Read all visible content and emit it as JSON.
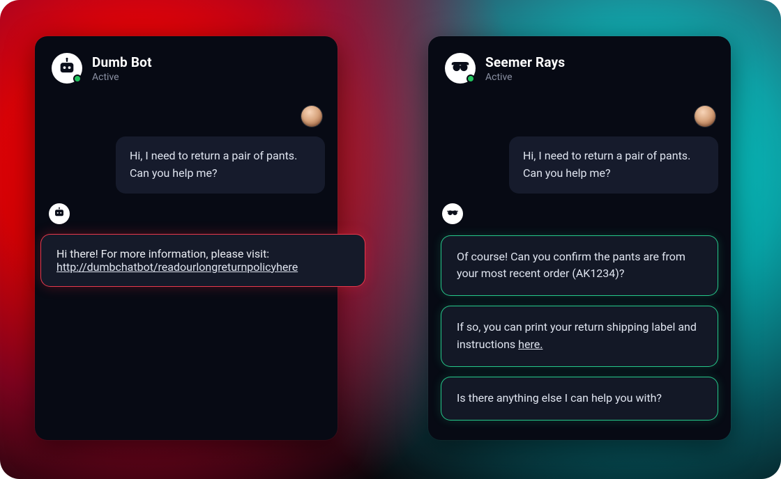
{
  "left": {
    "name": "Dumb Bot",
    "status": "Active",
    "user_msg": "Hi, I need to return a pair of pants. Can you help me?",
    "bot_line_prefix": "Hi there! For more information, please visit:",
    "bot_link": "http://dumbchatbot/readourlongreturnpolicyhere"
  },
  "right": {
    "name": "Seemer Rays",
    "status": "Active",
    "user_msg": "Hi, I need to return a pair of pants. Can you help me?",
    "bot_msg1": "Of course!  Can you confirm the pants are from your most recent order (AK1234)?",
    "bot_msg2_prefix": "If so, you can print your return shipping label and instructions ",
    "bot_msg2_link": "here.",
    "bot_msg3": "Is there anything else I can help you with?"
  }
}
